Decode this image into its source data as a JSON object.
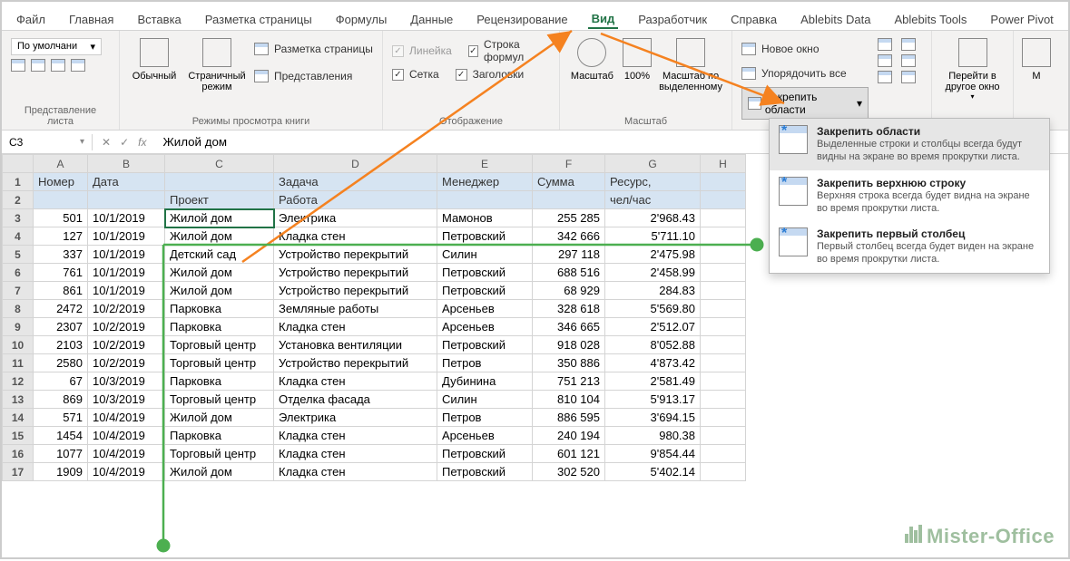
{
  "tabs": [
    "Файл",
    "Главная",
    "Вставка",
    "Разметка страницы",
    "Формулы",
    "Данные",
    "Рецензирование",
    "Вид",
    "Разработчик",
    "Справка",
    "Ablebits Data",
    "Ablebits Tools",
    "Power Pivot"
  ],
  "active_tab": "Вид",
  "ribbon": {
    "g1": {
      "label": "Представление листа",
      "dropdown": "По умолчани"
    },
    "g2": {
      "label": "Режимы просмотра книги",
      "normal": "Обычный",
      "page_break": "Страничный режим",
      "page_layout": "Разметка страницы",
      "custom_views": "Представления"
    },
    "g3": {
      "label": "Отображение",
      "ruler": "Линейка",
      "formula_bar": "Строка формул",
      "gridlines": "Сетка",
      "headings": "Заголовки"
    },
    "g4": {
      "label": "Масштаб",
      "zoom": "Масштаб",
      "p100": "100%",
      "zoom_sel": "Масштаб по выделенному"
    },
    "g5": {
      "new_window": "Новое окно",
      "arrange": "Упорядочить все",
      "freeze": "Закрепить области"
    },
    "g6": {
      "switch": "Перейти в другое окно",
      "macros": "М"
    }
  },
  "name_box": "C3",
  "formula": "Жилой дом",
  "columns": [
    "A",
    "B",
    "C",
    "D",
    "E",
    "F",
    "G",
    "H"
  ],
  "header1": {
    "A": "Номер",
    "B": "Дата",
    "D": "Задача",
    "E": "Менеджер",
    "F": "Сумма",
    "G": "Ресурс,"
  },
  "header2": {
    "C": "Проект",
    "D": "Работа",
    "G": "чел/час"
  },
  "rows": [
    {
      "n": "3",
      "num": "501",
      "date": "10/1/2019",
      "project": "Жилой дом",
      "task": "Электрика",
      "mgr": "Мамонов",
      "sum": "255 285",
      "res": "2'968.43"
    },
    {
      "n": "4",
      "num": "127",
      "date": "10/1/2019",
      "project": "Жилой дом",
      "task": "Кладка стен",
      "mgr": "Петровский",
      "sum": "342 666",
      "res": "5'711.10"
    },
    {
      "n": "5",
      "num": "337",
      "date": "10/1/2019",
      "project": "Детский сад",
      "task": "Устройство перекрытий",
      "mgr": "Силин",
      "sum": "297 118",
      "res": "2'475.98"
    },
    {
      "n": "6",
      "num": "761",
      "date": "10/1/2019",
      "project": "Жилой дом",
      "task": "Устройство перекрытий",
      "mgr": "Петровский",
      "sum": "688 516",
      "res": "2'458.99"
    },
    {
      "n": "7",
      "num": "861",
      "date": "10/1/2019",
      "project": "Жилой дом",
      "task": "Устройство перекрытий",
      "mgr": "Петровский",
      "sum": "68 929",
      "res": "284.83"
    },
    {
      "n": "8",
      "num": "2472",
      "date": "10/2/2019",
      "project": "Парковка",
      "task": "Земляные работы",
      "mgr": "Арсеньев",
      "sum": "328 618",
      "res": "5'569.80"
    },
    {
      "n": "9",
      "num": "2307",
      "date": "10/2/2019",
      "project": "Парковка",
      "task": "Кладка стен",
      "mgr": "Арсеньев",
      "sum": "346 665",
      "res": "2'512.07"
    },
    {
      "n": "10",
      "num": "2103",
      "date": "10/2/2019",
      "project": "Торговый центр",
      "task": "Установка вентиляции",
      "mgr": "Петровский",
      "sum": "918 028",
      "res": "8'052.88"
    },
    {
      "n": "11",
      "num": "2580",
      "date": "10/2/2019",
      "project": "Торговый центр",
      "task": "Устройство перекрытий",
      "mgr": "Петров",
      "sum": "350 886",
      "res": "4'873.42"
    },
    {
      "n": "12",
      "num": "67",
      "date": "10/3/2019",
      "project": "Парковка",
      "task": "Кладка стен",
      "mgr": "Дубинина",
      "sum": "751 213",
      "res": "2'581.49"
    },
    {
      "n": "13",
      "num": "869",
      "date": "10/3/2019",
      "project": "Торговый центр",
      "task": "Отделка фасада",
      "mgr": "Силин",
      "sum": "810 104",
      "res": "5'913.17"
    },
    {
      "n": "14",
      "num": "571",
      "date": "10/4/2019",
      "project": "Жилой дом",
      "task": "Электрика",
      "mgr": "Петров",
      "sum": "886 595",
      "res": "3'694.15"
    },
    {
      "n": "15",
      "num": "1454",
      "date": "10/4/2019",
      "project": "Парковка",
      "task": "Кладка стен",
      "mgr": "Арсеньев",
      "sum": "240 194",
      "res": "980.38"
    },
    {
      "n": "16",
      "num": "1077",
      "date": "10/4/2019",
      "project": "Торговый центр",
      "task": "Кладка стен",
      "mgr": "Петровский",
      "sum": "601 121",
      "res": "9'854.44"
    },
    {
      "n": "17",
      "num": "1909",
      "date": "10/4/2019",
      "project": "Жилой дом",
      "task": "Кладка стен",
      "mgr": "Петровский",
      "sum": "302 520",
      "res": "5'402.14"
    }
  ],
  "dropdown": {
    "i1": {
      "title": "Закрепить области",
      "desc": "Выделенные строки и столбцы всегда будут видны на экране во время прокрутки листа."
    },
    "i2": {
      "title": "Закрепить верхнюю строку",
      "desc": "Верхняя строка всегда будет видна на экране во время прокрутки листа."
    },
    "i3": {
      "title": "Закрепить первый столбец",
      "desc": "Первый столбец всегда будет виден на экране во время прокрутки листа."
    }
  },
  "watermark": "Mister-Office"
}
